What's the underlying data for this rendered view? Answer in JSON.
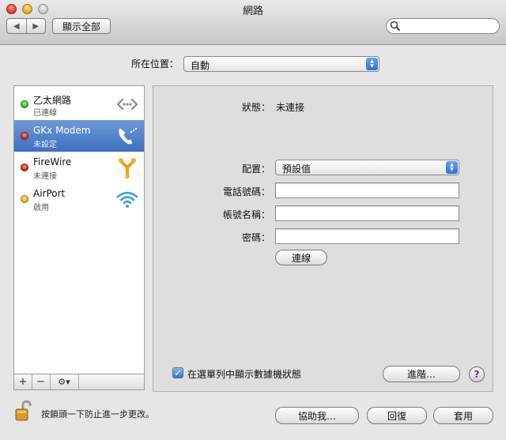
{
  "window": {
    "title": "網路"
  },
  "toolbar": {
    "back": "◀",
    "forward": "▶",
    "show_all": "顯示全部",
    "search_placeholder": ""
  },
  "location": {
    "label": "所在位置：",
    "value": "自動"
  },
  "services": [
    {
      "name": "乙太網路",
      "status": "已連線",
      "dot": "green",
      "icon": "ethernet-icon"
    },
    {
      "name": "GKx Modem",
      "status": "未設定",
      "dot": "red",
      "icon": "modem-phone-icon",
      "selected": true
    },
    {
      "name": "FireWire",
      "status": "未連接",
      "dot": "red",
      "icon": "firewire-icon"
    },
    {
      "name": "AirPort",
      "status": "啟用",
      "dot": "yellow",
      "icon": "airport-wifi-icon"
    }
  ],
  "sidebar_buttons": {
    "add": "+",
    "remove": "−",
    "action": "⚙▾"
  },
  "detail": {
    "status_label": "狀態：",
    "status_value": "未連接",
    "config_label": "配置：",
    "config_value": "預設值",
    "phone_label": "電話號碼：",
    "phone_value": "",
    "account_label": "帳號名稱：",
    "account_value": "",
    "password_label": "密碼：",
    "password_value": "",
    "connect_button": "連線",
    "show_status_checkbox": "在選單列中顯示數據機狀態",
    "show_status_checked": true,
    "advanced_button": "進階…",
    "help_button": "?"
  },
  "footer": {
    "lock_text": "按鎖頭一下防止進一步更改。",
    "assist_button": "協助我…",
    "revert_button": "回復",
    "apply_button": "套用"
  }
}
